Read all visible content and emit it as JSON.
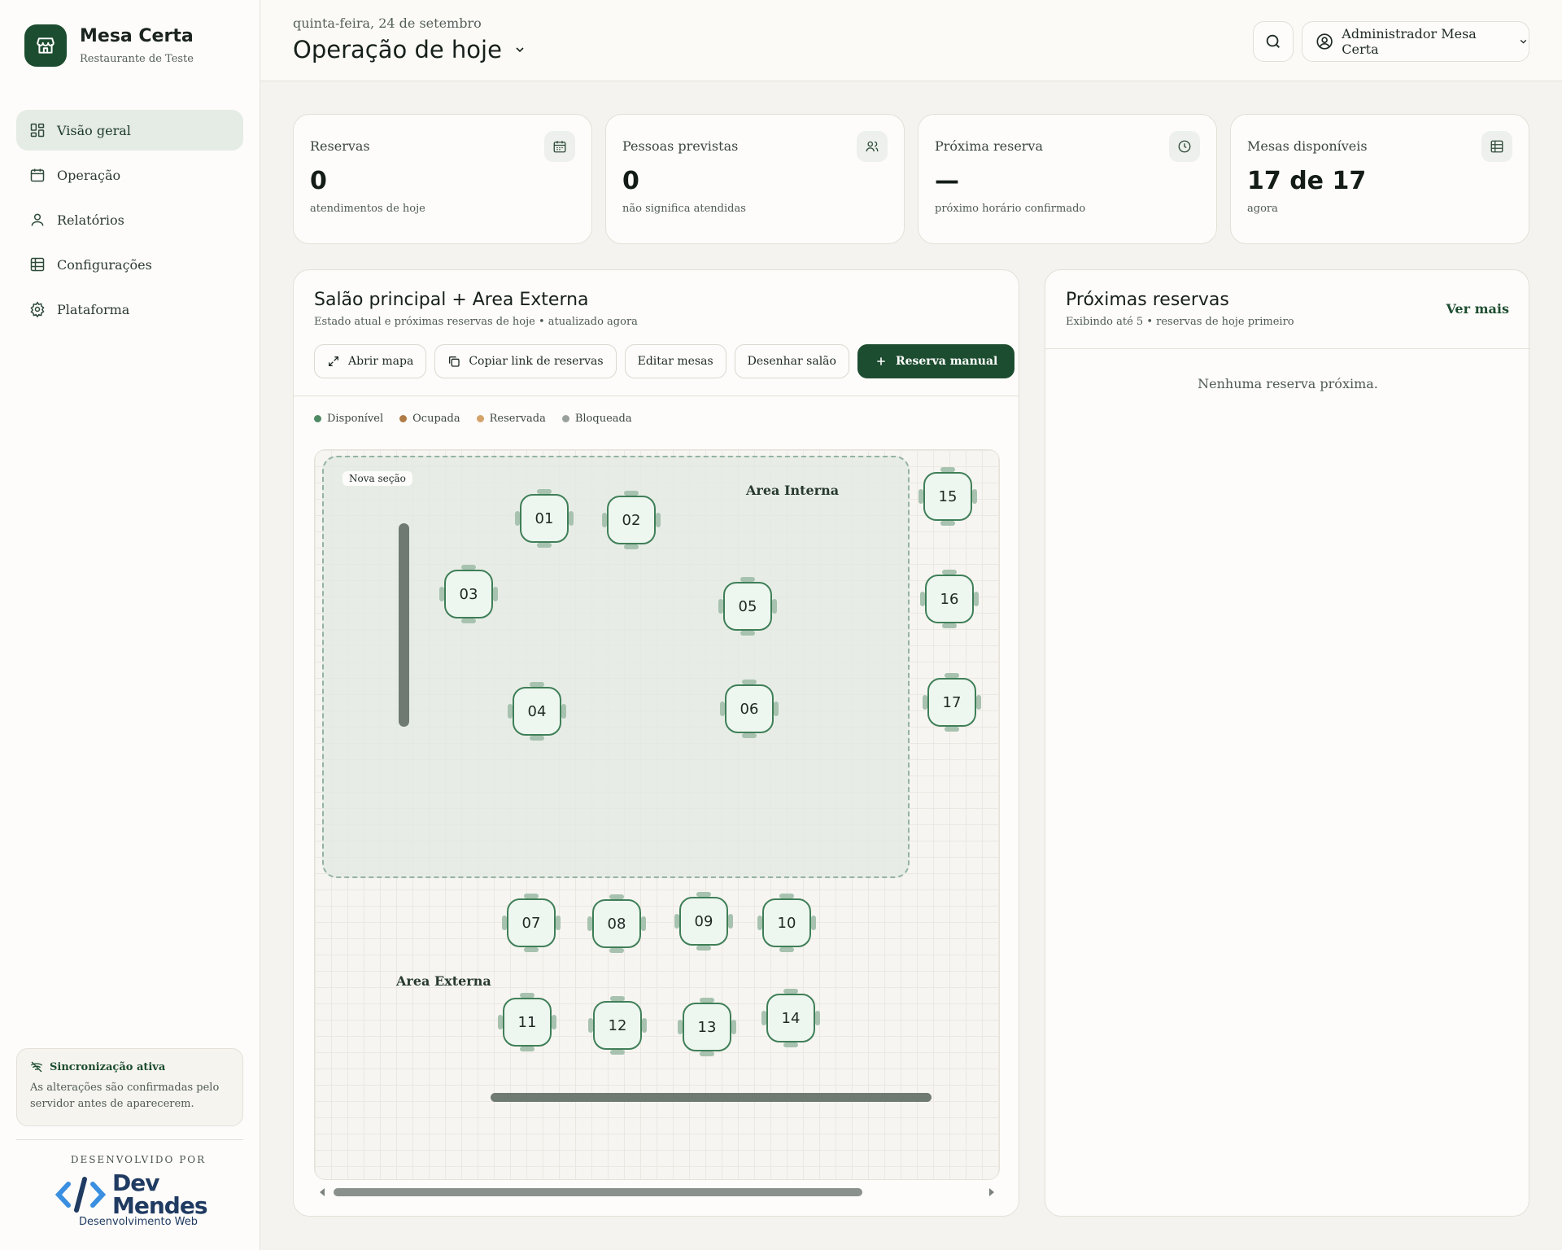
{
  "brand": {
    "name": "Mesa Certa",
    "subtitle": "Restaurante de Teste",
    "icon": "store-icon"
  },
  "nav": [
    {
      "label": "Visão geral",
      "icon": "dashboard-icon",
      "active": true
    },
    {
      "label": "Operação",
      "icon": "calendar-icon",
      "active": false
    },
    {
      "label": "Relatórios",
      "icon": "user-icon",
      "active": false
    },
    {
      "label": "Configurações",
      "icon": "table-icon",
      "active": false
    },
    {
      "label": "Plataforma",
      "icon": "gear-icon",
      "active": false
    }
  ],
  "sync": {
    "title": "Sincronização ativa",
    "text": "As alterações são confirmadas pelo servidor antes de aparecerem."
  },
  "credits": {
    "developed_by": "DESENVOLVIDO POR",
    "name_line1": "Dev",
    "name_line2": "Mendes",
    "tagline": "Desenvolvimento Web"
  },
  "header": {
    "date": "quinta-feira, 24 de setembro",
    "title": "Operação de hoje",
    "user": "Administrador Mesa Certa"
  },
  "stats": [
    {
      "label": "Reservas",
      "value": "0",
      "sub": "atendimentos de hoje",
      "icon": "calendar-icon"
    },
    {
      "label": "Pessoas previstas",
      "value": "0",
      "sub": "não significa atendidas",
      "icon": "people-icon"
    },
    {
      "label": "Próxima reserva",
      "value": "—",
      "sub": "próximo horário confirmado",
      "icon": "clock-icon"
    },
    {
      "label": "Mesas disponíveis",
      "value": "17 de 17",
      "sub": "agora",
      "icon": "table-icon"
    }
  ],
  "floor": {
    "title": "Salão principal + Area Externa",
    "subtitle": "Estado atual e próximas reservas de hoje • atualizado agora",
    "buttons": {
      "open_map": "Abrir mapa",
      "copy_link": "Copiar link de reservas",
      "edit_tables": "Editar mesas",
      "draw_room": "Desenhar salão",
      "manual_booking": "Reserva manual"
    },
    "legend": [
      {
        "label": "Disponível",
        "color": "#4e8a64"
      },
      {
        "label": "Ocupada",
        "color": "#b07a45"
      },
      {
        "label": "Reservada",
        "color": "#d4a36a"
      },
      {
        "label": "Bloqueada",
        "color": "#9aa19c"
      }
    ],
    "section_tag": "Nova seção",
    "area_internal": "Area Interna",
    "area_external": "Area Externa",
    "tables": [
      "01",
      "02",
      "03",
      "04",
      "05",
      "06",
      "07",
      "08",
      "09",
      "10",
      "11",
      "12",
      "13",
      "14",
      "15",
      "16",
      "17"
    ]
  },
  "upcoming": {
    "title": "Próximas reservas",
    "subtitle": "Exibindo até 5 • reservas de hoje primeiro",
    "more": "Ver mais",
    "empty": "Nenhuma reserva próxima."
  }
}
